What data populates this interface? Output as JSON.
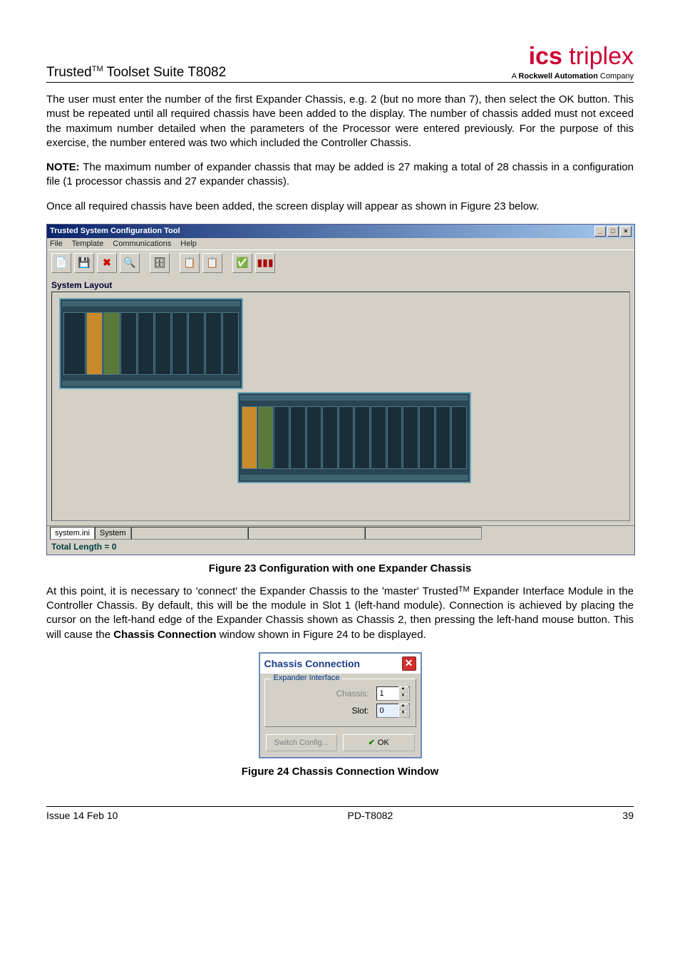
{
  "header": {
    "title_prefix": "Trusted",
    "title_tm": "TM",
    "title_suffix": " Toolset Suite T8082",
    "logo_text": "ics",
    "logo_text2": " triplex",
    "logo_sub_prefix": "A ",
    "logo_sub_bold": "Rockwell Automation",
    "logo_sub_suffix": " Company"
  },
  "paragraphs": {
    "p1": "The user must enter the number of the first Expander Chassis, e.g. 2 (but no more than 7), then select the OK button.  This must be repeated until all required chassis have been added to the display.  The number of chassis added must not exceed the maximum number detailed when the parameters of the Processor were entered previously.   For the purpose of this exercise, the number entered was two which included the Controller Chassis.",
    "note_label": "NOTE:",
    "p2": " The maximum number of expander chassis that may be added is 27 making a total of 28 chassis in a configuration file (1 processor chassis and 27 expander chassis).",
    "p3": "Once all required chassis have been added, the screen display will appear as shown in Figure 23 below.",
    "p4_a": "At this point, it is necessary to 'connect' the Expander Chassis to the 'master' Trusted",
    "p4_tm": "TM",
    "p4_b": " Expander Interface Module in the Controller Chassis.  By default, this will be the module in Slot 1 (left-hand module).  Connection is achieved by placing the cursor on the left-hand edge of the Expander Chassis shown as Chassis 2, then pressing the left-hand mouse button.   This will cause the ",
    "p4_bold": "Chassis Connection",
    "p4_c": " window shown in Figure 24 to be displayed."
  },
  "captions": {
    "fig23": "Figure 23 Configuration with one Expander Chassis",
    "fig24": "Figure 24 Chassis Connection Window"
  },
  "app": {
    "title": "Trusted System Configuration Tool",
    "menu": {
      "file": "File",
      "template": "Template",
      "comm": "Communications",
      "help": "Help"
    },
    "layout_label": "System Layout",
    "status_file": "system.ini",
    "status_tab": "System",
    "total_length": "Total Length = 0"
  },
  "dialog": {
    "title": "Chassis Connection",
    "group": "Expander Interface",
    "chassis_label": "Chassis:",
    "chassis_value": "1",
    "slot_label": "Slot:",
    "slot_value": "0",
    "switch_btn": "Switch Config...",
    "ok_btn": "OK"
  },
  "footer": {
    "left": "Issue 14 Feb 10",
    "center": "PD-T8082",
    "right": "39"
  }
}
